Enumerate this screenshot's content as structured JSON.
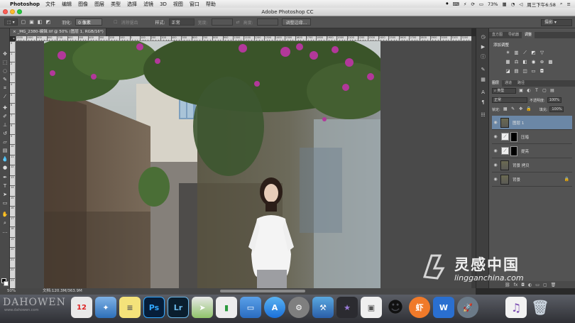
{
  "menubar": {
    "app_name": "Photoshop",
    "menus": [
      "文件",
      "编辑",
      "图像",
      "图层",
      "类型",
      "选择",
      "滤镜",
      "3D",
      "视图",
      "窗口",
      "帮助"
    ],
    "battery": "73%",
    "clock": "周三下午6:58"
  },
  "window": {
    "title": "Adobe Photoshop CC"
  },
  "options": {
    "feather_label": "羽化:",
    "feather_value": "0 像素",
    "antialias_label": "消除锯齿",
    "style_label": "样式:",
    "style_value": "正常",
    "width_label": "宽度:",
    "height_label": "高度:",
    "refine_edge_button": "调整边缘...",
    "workspace": "摄影"
  },
  "document": {
    "tab_label": "_MG_2380-编辑.tif @ 50% (图层 1, RGB/16*) *",
    "zoom": "50%",
    "doc_info": "文档:120.3M/363.9M"
  },
  "ruler": {
    "top_numbers": [
      "1100",
      "1000",
      "900",
      "800",
      "700",
      "600",
      "500",
      "400",
      "300",
      "200",
      "100",
      "0",
      "100",
      "200",
      "300",
      "400",
      "500",
      "600",
      "700",
      "800",
      "900",
      "1000",
      "1100",
      "1200",
      "1300",
      "1400",
      "1500",
      "1600",
      "1700",
      "1800",
      "1900",
      "2000",
      "2100",
      "2200",
      "2300",
      "2400",
      "2500",
      "2600",
      "2700",
      "2800",
      "2900",
      "3000",
      "3100",
      "3200"
    ],
    "left_numbers": [
      "0",
      "1",
      "2",
      "3",
      "4",
      "5",
      "6",
      "7",
      "8",
      "9",
      "10",
      "11",
      "12",
      "13",
      "14",
      "15",
      "16",
      "17",
      "18",
      "19",
      "20",
      "21",
      "22",
      "23"
    ]
  },
  "panels": {
    "top_tabs": [
      "直方图",
      "导航器",
      "调整"
    ],
    "adjust_title": "添加调整",
    "layer_tabs": [
      "图层",
      "通道",
      "路径"
    ],
    "kind_select": "类型",
    "blend_mode": "正常",
    "opacity_label": "不透明度:",
    "opacity_value": "100%",
    "lock_label": "锁定:",
    "fill_label": "填充:",
    "fill_value": "100%",
    "layers": [
      {
        "name": "图层 1",
        "type": "pixel",
        "selected": true
      },
      {
        "name": "压暗",
        "type": "curves",
        "selected": false
      },
      {
        "name": "提亮",
        "type": "curves",
        "selected": false
      },
      {
        "name": "背景 拷贝",
        "type": "pixel",
        "selected": false
      },
      {
        "name": "背景",
        "type": "pixel",
        "locked": true,
        "selected": false
      }
    ]
  },
  "dock": {
    "apps": [
      "finder-icon",
      "launchpad-icon",
      "calendar-icon",
      "preview-icon",
      "notes-icon",
      "photoshop-icon",
      "lightroom-icon",
      "maps-icon",
      "numbers-icon",
      "keynote-icon",
      "appstore-icon",
      "system-preferences-icon",
      "xcode-icon",
      "imovie-icon",
      "photos-icon",
      "qq-icon",
      "xiami-icon",
      "word-icon",
      "rocket-icon",
      "itunes-icon",
      "trash-icon"
    ],
    "calendar_day": "12",
    "ps_label": "Ps",
    "lr_label": "Lr"
  },
  "watermark": {
    "brand": "灵感中国",
    "url": "lingganchina.com",
    "left_brand": "DAHOWEN",
    "left_sub": "www.dahowen.com"
  }
}
